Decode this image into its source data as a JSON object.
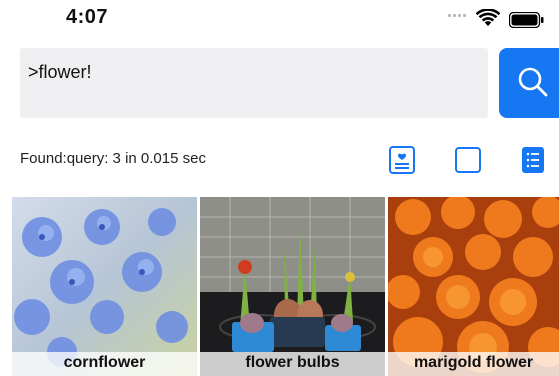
{
  "status_bar": {
    "time": "4:07",
    "icons": [
      "cellular-signal-icon",
      "wifi-icon",
      "battery-icon"
    ]
  },
  "search": {
    "query": ">flower!",
    "button_icon": "search-icon"
  },
  "results": {
    "found_text": "Found:query: 3 in 0.015 sec"
  },
  "view_toggles": [
    {
      "icon": "detail-view-icon",
      "selected": false
    },
    {
      "icon": "blank-view-icon",
      "selected": false
    },
    {
      "icon": "list-view-icon",
      "selected": true
    }
  ],
  "photos": [
    {
      "caption": "cornflower",
      "icon": "cornflower-photo"
    },
    {
      "caption": "flower bulbs",
      "icon": "flower-bulbs-photo"
    },
    {
      "caption": "marigold flower",
      "icon": "marigold-photo"
    }
  ],
  "colors": {
    "accent": "#1677f2",
    "search_field_bg": "#efeff1"
  }
}
